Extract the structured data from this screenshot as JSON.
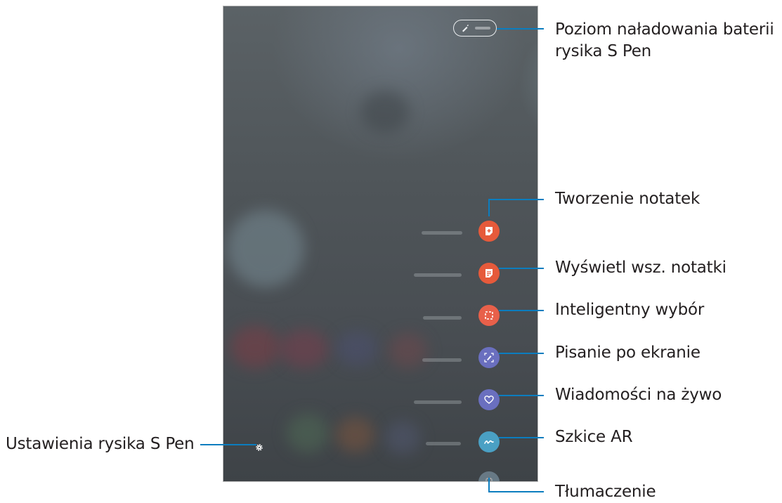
{
  "screen": {
    "battery_indicator": "s-pen-battery-level",
    "commands": [
      {
        "id": "create-note",
        "icon": "note-plus-icon",
        "color": "#e65a3b"
      },
      {
        "id": "view-all-notes",
        "icon": "notes-list-icon",
        "color": "#e65a3b"
      },
      {
        "id": "smart-select",
        "icon": "smart-select-icon",
        "color": "#e8604a"
      },
      {
        "id": "screen-write",
        "icon": "screen-write-icon",
        "color": "#6a6fbf"
      },
      {
        "id": "live-message",
        "icon": "live-message-heart-icon",
        "color": "#6a6fbf"
      },
      {
        "id": "ar-doodle",
        "icon": "ar-doodle-icon",
        "color": "#4aa0c4"
      },
      {
        "id": "translate",
        "icon": "translate-icon",
        "color": "#8aa6b8"
      }
    ],
    "settings_icon": "gear-icon"
  },
  "callouts": {
    "battery_line1": "Poziom naładowania baterii",
    "battery_line2": "rysika S Pen",
    "create_note": "Tworzenie notatek",
    "view_all_notes": "Wyświetl wsz. notatki",
    "smart_select": "Inteligentny wybór",
    "screen_write": "Pisanie po ekranie",
    "live_message": "Wiadomości na żywo",
    "ar_doodle": "Szkice AR",
    "translate": "Tłumaczenie",
    "settings": "Ustawienia rysika S Pen"
  },
  "colors": {
    "callout_line": "#0b7dbf",
    "label_text": "#231f20"
  }
}
